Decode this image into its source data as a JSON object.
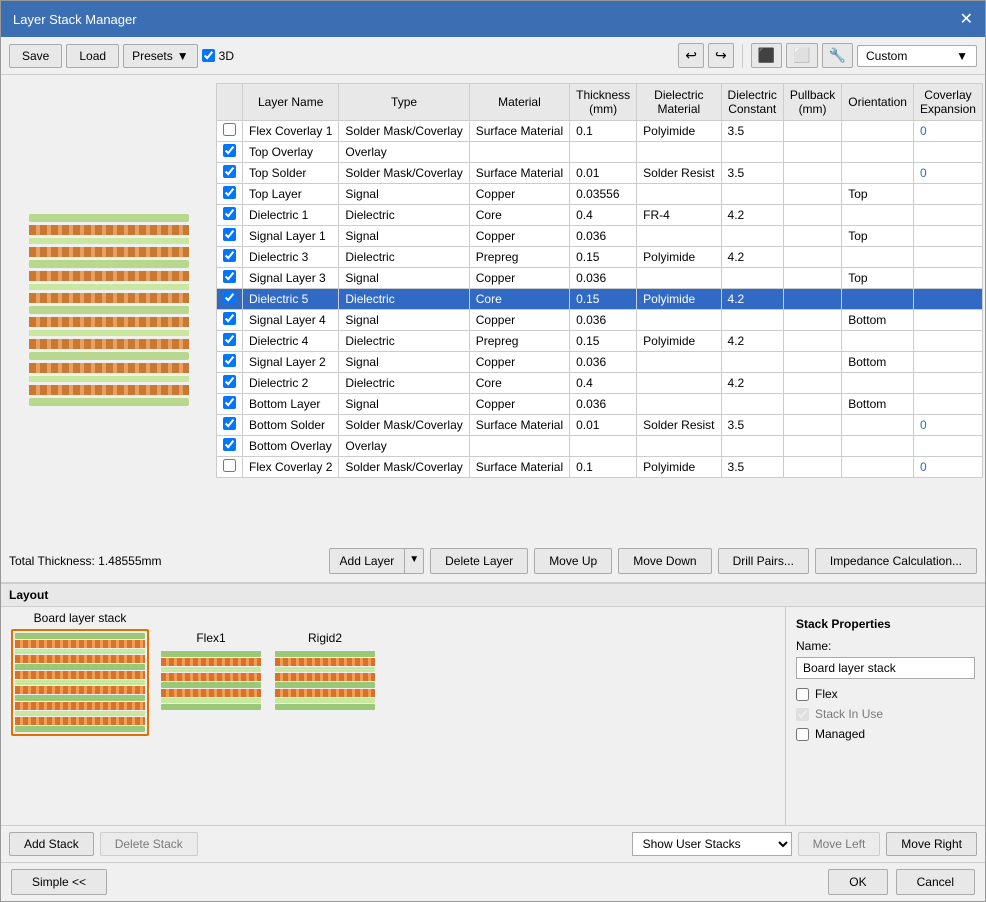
{
  "window": {
    "title": "Layer Stack Manager"
  },
  "toolbar": {
    "save_label": "Save",
    "load_label": "Load",
    "presets_label": "Presets",
    "checkbox_3d_label": "3D",
    "custom_label": "Custom",
    "undo_icon": "↩",
    "redo_icon": "↪"
  },
  "table": {
    "headers": [
      "",
      "Layer Name",
      "Type",
      "Material",
      "Thickness\n(mm)",
      "Dielectric\nMaterial",
      "Dielectric\nConstant",
      "Pullback\n(mm)",
      "Orientation",
      "Coverlay\nExpansion"
    ],
    "rows": [
      {
        "checked": false,
        "name": "Flex Coverlay 1",
        "type": "Solder Mask/Coverlay",
        "material": "Surface Material",
        "thickness": "0.1",
        "diel_material": "Polyimide",
        "diel_constant": "3.5",
        "pullback": "",
        "orientation": "",
        "coverlay": "0",
        "selected": false
      },
      {
        "checked": true,
        "name": "Top Overlay",
        "type": "Overlay",
        "material": "",
        "thickness": "",
        "diel_material": "",
        "diel_constant": "",
        "pullback": "",
        "orientation": "",
        "coverlay": "",
        "selected": false
      },
      {
        "checked": true,
        "name": "Top Solder",
        "type": "Solder Mask/Coverlay",
        "material": "Surface Material",
        "thickness": "0.01",
        "diel_material": "Solder Resist",
        "diel_constant": "3.5",
        "pullback": "",
        "orientation": "",
        "coverlay": "0",
        "selected": false
      },
      {
        "checked": true,
        "name": "Top Layer",
        "type": "Signal",
        "material": "Copper",
        "thickness": "0.03556",
        "diel_material": "",
        "diel_constant": "",
        "pullback": "",
        "orientation": "Top",
        "coverlay": "",
        "selected": false
      },
      {
        "checked": true,
        "name": "Dielectric 1",
        "type": "Dielectric",
        "material": "Core",
        "thickness": "0.4",
        "diel_material": "FR-4",
        "diel_constant": "4.2",
        "pullback": "",
        "orientation": "",
        "coverlay": "",
        "selected": false
      },
      {
        "checked": true,
        "name": "Signal Layer 1",
        "type": "Signal",
        "material": "Copper",
        "thickness": "0.036",
        "diel_material": "",
        "diel_constant": "",
        "pullback": "",
        "orientation": "Top",
        "coverlay": "",
        "selected": false
      },
      {
        "checked": true,
        "name": "Dielectric 3",
        "type": "Dielectric",
        "material": "Prepreg",
        "thickness": "0.15",
        "diel_material": "Polyimide",
        "diel_constant": "4.2",
        "pullback": "",
        "orientation": "",
        "coverlay": "",
        "selected": false
      },
      {
        "checked": true,
        "name": "Signal Layer 3",
        "type": "Signal",
        "material": "Copper",
        "thickness": "0.036",
        "diel_material": "",
        "diel_constant": "",
        "pullback": "",
        "orientation": "Top",
        "coverlay": "",
        "selected": false
      },
      {
        "checked": true,
        "name": "Dielectric 5",
        "type": "Dielectric",
        "material": "Core",
        "thickness": "0.15",
        "diel_material": "Polyimide",
        "diel_constant": "4.2",
        "pullback": "",
        "orientation": "",
        "coverlay": "",
        "selected": true
      },
      {
        "checked": true,
        "name": "Signal Layer 4",
        "type": "Signal",
        "material": "Copper",
        "thickness": "0.036",
        "diel_material": "",
        "diel_constant": "",
        "pullback": "",
        "orientation": "Bottom",
        "coverlay": "",
        "selected": false
      },
      {
        "checked": true,
        "name": "Dielectric 4",
        "type": "Dielectric",
        "material": "Prepreg",
        "thickness": "0.15",
        "diel_material": "Polyimide",
        "diel_constant": "4.2",
        "pullback": "",
        "orientation": "",
        "coverlay": "",
        "selected": false
      },
      {
        "checked": true,
        "name": "Signal Layer 2",
        "type": "Signal",
        "material": "Copper",
        "thickness": "0.036",
        "diel_material": "",
        "diel_constant": "",
        "pullback": "",
        "orientation": "Bottom",
        "coverlay": "",
        "selected": false
      },
      {
        "checked": true,
        "name": "Dielectric 2",
        "type": "Dielectric",
        "material": "Core",
        "thickness": "0.4",
        "diel_material": "",
        "diel_constant": "4.2",
        "pullback": "",
        "orientation": "",
        "coverlay": "",
        "selected": false
      },
      {
        "checked": true,
        "name": "Bottom Layer",
        "type": "Signal",
        "material": "Copper",
        "thickness": "0.036",
        "diel_material": "",
        "diel_constant": "",
        "pullback": "",
        "orientation": "Bottom",
        "coverlay": "",
        "selected": false
      },
      {
        "checked": true,
        "name": "Bottom Solder",
        "type": "Solder Mask/Coverlay",
        "material": "Surface Material",
        "thickness": "0.01",
        "diel_material": "Solder Resist",
        "diel_constant": "3.5",
        "pullback": "",
        "orientation": "",
        "coverlay": "0",
        "selected": false
      },
      {
        "checked": true,
        "name": "Bottom Overlay",
        "type": "Overlay",
        "material": "",
        "thickness": "",
        "diel_material": "",
        "diel_constant": "",
        "pullback": "",
        "orientation": "",
        "coverlay": "",
        "selected": false
      },
      {
        "checked": false,
        "name": "Flex Coverlay 2",
        "type": "Solder Mask/Coverlay",
        "material": "Surface Material",
        "thickness": "0.1",
        "diel_material": "Polyimide",
        "diel_constant": "3.5",
        "pullback": "",
        "orientation": "",
        "coverlay": "0",
        "selected": false
      }
    ]
  },
  "action_bar": {
    "total_thickness_label": "Total Thickness: 1.48555mm",
    "add_layer_label": "Add Layer",
    "delete_layer_label": "Delete Layer",
    "move_up_label": "Move Up",
    "move_down_label": "Move Down",
    "drill_pairs_label": "Drill Pairs...",
    "impedance_label": "Impedance Calculation..."
  },
  "layout": {
    "label": "Layout",
    "stacks": [
      {
        "name": "Board layer stack",
        "active": true
      },
      {
        "name": "Flex1",
        "active": false
      },
      {
        "name": "Rigid2",
        "active": false
      }
    ]
  },
  "stack_properties": {
    "title": "Stack Properties",
    "name_label": "Name:",
    "name_value": "Board layer stack",
    "flex_label": "Flex",
    "stack_in_use_label": "Stack In Use",
    "managed_label": "Managed"
  },
  "bottom_buttons": {
    "add_stack_label": "Add Stack",
    "delete_stack_label": "Delete Stack",
    "show_user_stacks_label": "Show User Stacks",
    "move_left_label": "Move Left",
    "move_right_label": "Move Right"
  },
  "footer": {
    "simple_label": "Simple <<",
    "ok_label": "OK",
    "cancel_label": "Cancel"
  }
}
